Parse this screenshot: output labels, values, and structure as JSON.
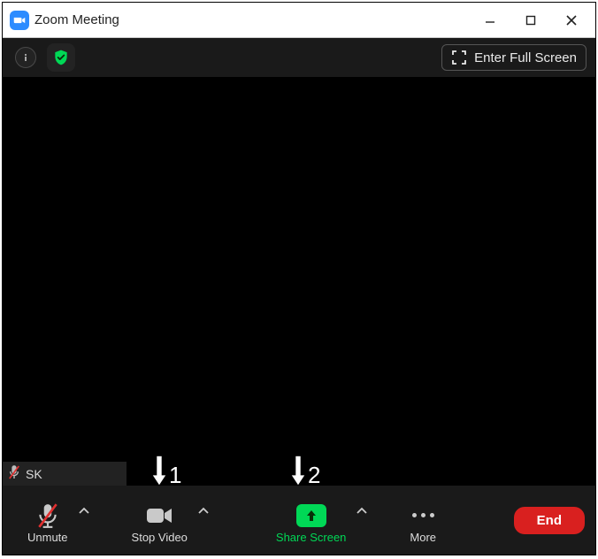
{
  "window": {
    "title": "Zoom Meeting"
  },
  "topbar": {
    "full_screen_label": "Enter Full Screen"
  },
  "self_view": {
    "initials": "SK"
  },
  "annotations": {
    "arrow1": "1",
    "arrow2": "2"
  },
  "toolbar": {
    "unmute_label": "Unmute",
    "stop_video_label": "Stop Video",
    "share_screen_label": "Share Screen",
    "more_label": "More",
    "end_label": "End"
  }
}
